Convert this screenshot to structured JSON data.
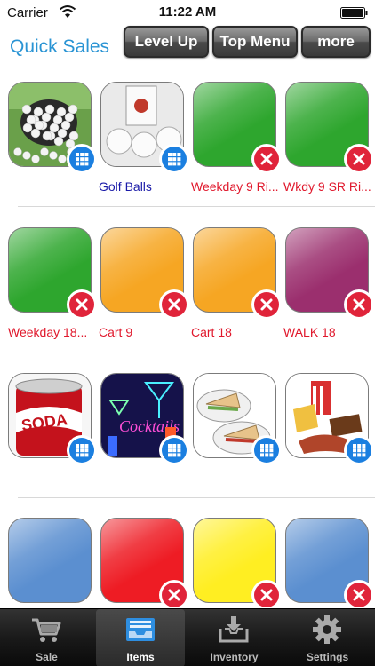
{
  "status_bar": {
    "carrier": "Carrier",
    "time": "11:22 AM"
  },
  "header": {
    "title": "Quick Sales",
    "buttons": {
      "level_up": "Level Up",
      "top_menu": "Top Menu",
      "more": "more"
    }
  },
  "tiles": [
    {
      "label": "",
      "label_color": "#1a1aa8",
      "image": "golf-driving-range-balls",
      "badge": "grid-icon"
    },
    {
      "label": "Golf Balls",
      "label_color": "#1a1aa8",
      "image": "golf-ball-box",
      "badge": "grid-icon"
    },
    {
      "label": "Weekday 9 Ri...",
      "label_color": "#e0182c",
      "image": "green",
      "color": "#2ea62e",
      "badge": "delete-icon"
    },
    {
      "label": "Wkdy 9 SR Ri...",
      "label_color": "#e0182c",
      "image": "green",
      "color": "#2ea62e",
      "badge": "delete-icon"
    },
    {
      "label": "Weekday 18...",
      "label_color": "#e0182c",
      "image": "green",
      "color": "#2ea62e",
      "badge": "delete-icon"
    },
    {
      "label": "Cart 9",
      "label_color": "#e0182c",
      "image": "orange",
      "color": "#f6a623",
      "badge": "delete-icon"
    },
    {
      "label": "Cart 18",
      "label_color": "#e0182c",
      "image": "orange",
      "color": "#f6a623",
      "badge": "delete-icon"
    },
    {
      "label": "WALK 18",
      "label_color": "#e0182c",
      "image": "purple",
      "color": "#9b2f6e",
      "badge": "delete-icon"
    },
    {
      "label": "",
      "label_color": "#1a1aa8",
      "image": "soda-can",
      "badge": "grid-icon"
    },
    {
      "label": "",
      "label_color": "#1a1aa8",
      "image": "cocktails-neon",
      "badge": "grid-icon"
    },
    {
      "label": "",
      "label_color": "#1a1aa8",
      "image": "sandwiches",
      "badge": "grid-icon"
    },
    {
      "label": "",
      "label_color": "#1a1aa8",
      "image": "snack-food",
      "badge": "grid-icon"
    },
    {
      "label": "",
      "label_color": "#e0182c",
      "image": "blue",
      "color": "#5b8fd0",
      "badge": "none"
    },
    {
      "label": "",
      "label_color": "#e0182c",
      "image": "red",
      "color": "#ee1c24",
      "badge": "delete-icon"
    },
    {
      "label": "",
      "label_color": "#e0182c",
      "image": "yellow",
      "color": "#ffee22",
      "badge": "delete-icon"
    },
    {
      "label": "",
      "label_color": "#e0182c",
      "image": "blue",
      "color": "#5b8fd0",
      "badge": "delete-icon"
    }
  ],
  "tab_bar": {
    "tabs": [
      {
        "label": "Sale",
        "icon": "cart-icon"
      },
      {
        "label": "Items",
        "icon": "inbox-tray-icon"
      },
      {
        "label": "Inventory",
        "icon": "download-tray-icon"
      },
      {
        "label": "Settings",
        "icon": "gear-icon"
      }
    ],
    "active": "Items"
  }
}
